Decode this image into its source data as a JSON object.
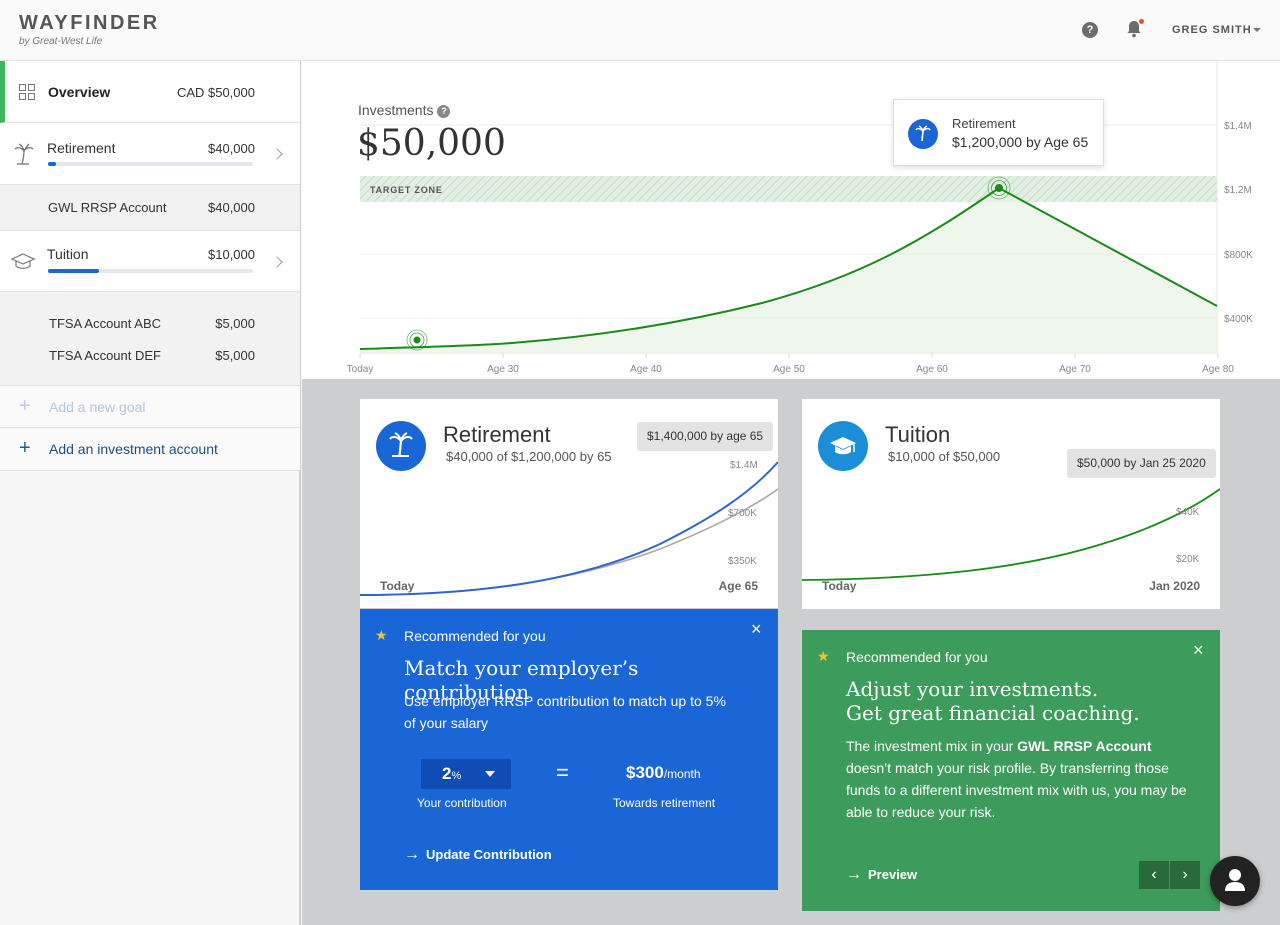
{
  "header": {
    "logo": "WAYFINDER",
    "logo_sub": "by Great-West Life",
    "help_icon": "help-circle-icon",
    "bell_icon": "bell-icon",
    "user_name": "GREG SMITH"
  },
  "sidebar": {
    "overview": {
      "label": "Overview",
      "amount": "CAD $50,000"
    },
    "goals": [
      {
        "label": "Retirement",
        "amount": "$40,000",
        "progress": 0.04,
        "accounts": [
          {
            "label": "GWL RRSP Account",
            "amount": "$40,000"
          }
        ]
      },
      {
        "label": "Tuition",
        "amount": "$10,000",
        "progress": 0.25,
        "accounts": [
          {
            "label": "TFSA Account ABC",
            "amount": "$5,000"
          },
          {
            "label": "TFSA Account DEF",
            "amount": "$5,000"
          }
        ]
      }
    ],
    "add_goal": "Add a new goal",
    "add_account": "Add an investment account"
  },
  "overview_chart": {
    "label": "Investments",
    "value": "$50,000",
    "target_zone": "TARGET ZONE",
    "tooltip": {
      "title": "Retirement",
      "value": "$1,200,000 by Age 65"
    },
    "y_ticks": [
      "$1.4M",
      "$1.2M",
      "$800K",
      "$400K"
    ],
    "x_ticks": [
      "Today",
      "Age 30",
      "Age 40",
      "Age 50",
      "Age 60",
      "Age 70",
      "Age 80"
    ]
  },
  "cards": {
    "retirement": {
      "title": "Retirement",
      "subtitle": "$40,000 of $1,200,000 by 65",
      "pill": "$1,400,000 by age 65",
      "y_ticks": [
        "$1.4M",
        "$700K",
        "$350K"
      ],
      "x_start": "Today",
      "x_end": "Age 65"
    },
    "tuition": {
      "title": "Tuition",
      "subtitle": "$10,000 of $50,000",
      "pill": "$50,000 by Jan 25 2020",
      "y_ticks": [
        "$40K",
        "$20K"
      ],
      "x_start": "Today",
      "x_end": "Jan 2020"
    }
  },
  "rec_blue": {
    "header": "Recommended for you",
    "title": "Match your employer’s contribution",
    "body": "Use employer RRSP contribution to match up to 5% of your salary",
    "contribution_value": "2",
    "contribution_unit": "%",
    "contribution_label": "Your contribution",
    "equals": "=",
    "result_value": "$300",
    "result_unit": "/month",
    "result_label": "Towards retirement",
    "action": "Update Contribution"
  },
  "rec_green": {
    "header": "Recommended for you",
    "title_line1": "Adjust your investments.",
    "title_line2": "Get great financial coaching.",
    "body_pre": "The investment mix in your ",
    "body_bold": "GWL RRSP Account",
    "body_post": " doesn’t match your risk profile. By transferring those funds to a different investment mix with us, you may be able to reduce your risk.",
    "action": "Preview"
  },
  "colors": {
    "brand_green": "#3cb55b",
    "blue": "#1a66d6",
    "green_card": "#3d9b5b",
    "chart_line": "#1a8a1a"
  }
}
